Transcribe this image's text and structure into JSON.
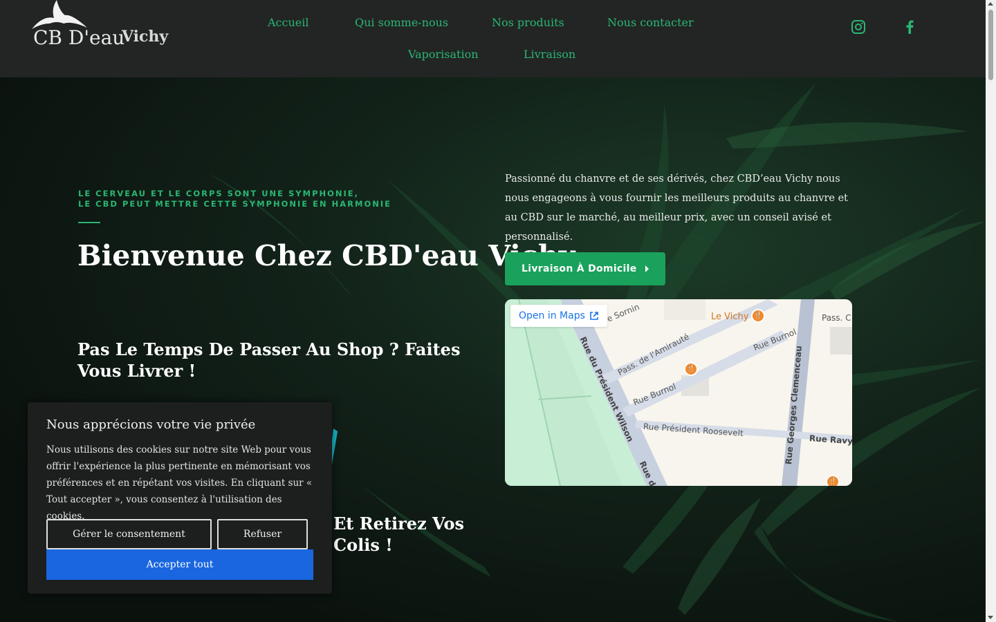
{
  "header": {
    "logo": {
      "brand": "CB D'eau",
      "city": "Vichy"
    },
    "nav": {
      "accueil": "Accueil",
      "qui": "Qui somme-nous",
      "produits": "Nos produits",
      "contact": "Nous contacter",
      "vaporisation": "Vaporisation",
      "livraison": "Livraison"
    },
    "social": {
      "instagram": "instagram-icon",
      "facebook": "facebook-icon"
    }
  },
  "hero": {
    "tagline_1": "LE CERVEAU ET LE CORPS SONT UNE SYMPHONIE,",
    "tagline_2": "LE CBD PEUT METTRE CETTE SYMPHONIE EN HARMONIE",
    "title": "Bienvenue Chez CBD'eau Vichy",
    "subtitle_1": "Pas Le Temps De Passer Au Shop ? Faites Vous Livrer !",
    "subtitle_2": "Et Retirez Vos Colis !",
    "intro": "Passionné du chanvre et de ses dérivés, chez CBD’eau Vichy nous nous engageons à vous fournir les meilleurs produits au chanvre et au CBD sur le marché, au meilleur prix, avec un conseil avisé et personnalisé.",
    "cta_label": "Livraison À Domicile"
  },
  "map": {
    "open_in_maps": "Open in Maps",
    "streets": {
      "president_wilson": "Rue du Président Wilson",
      "rue_d": "Rue d",
      "amiraute": "Pass. de l'Amirauté",
      "burnol_1": "Rue Burnol",
      "burnol_2": "Rue Burnol",
      "roosevelt": "Rue Président Roosevelt",
      "clemenceau": "Rue Georges Clemenceau",
      "ravy": "Rue Ravy",
      "sornin": "e Sornin",
      "pass_c": "Pass. C"
    },
    "poi": {
      "le_vichy": "Le Vichy"
    }
  },
  "cookie": {
    "title": "Nous apprécions votre vie privée",
    "text": "Nous utilisons des cookies sur notre site Web pour vous offrir l'expérience la plus pertinente en mémorisant vos préférences et en répétant vos visites. En cliquant sur « Tout accepter », vous consentez à l'utilisation des cookies.",
    "manage_label": "Gérer le consentement",
    "refuse_label": "Refuser",
    "accept_label": "Accepter tout"
  },
  "colors": {
    "accent": "#2bb673",
    "cta": "#1aa15b",
    "header_bg": "#222524",
    "accept_blue": "#1a66e0"
  }
}
